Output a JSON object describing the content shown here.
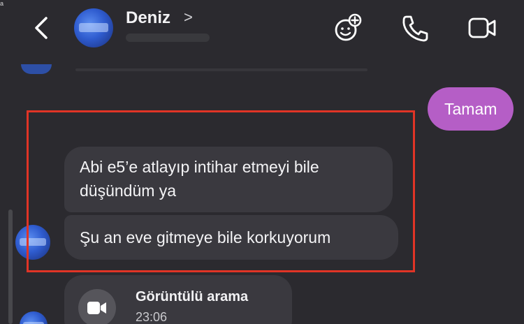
{
  "corner_mark": "a",
  "header": {
    "contact_name": "Deniz",
    "name_chevron": ">",
    "icons": [
      "back-icon",
      "sticker-add-icon",
      "phone-icon",
      "video-camera-icon"
    ]
  },
  "messages": {
    "sent": [
      {
        "text": "Tamam"
      }
    ],
    "received": [
      {
        "text": "Abi e5’e atlayıp intihar etmeyi bile düşündüm ya"
      },
      {
        "text": "Şu an eve gitmeye bile korkuyorum"
      }
    ],
    "video_call": {
      "title": "Görüntülü arama",
      "time": "23:06",
      "icon": "video-camera-icon"
    }
  },
  "colors": {
    "background": "#2b2a2f",
    "received_bubble": "#3a393f",
    "sent_bubble": "#b55ec6",
    "highlight_border": "#e03426",
    "avatar_blue": "#2f5ccf"
  }
}
